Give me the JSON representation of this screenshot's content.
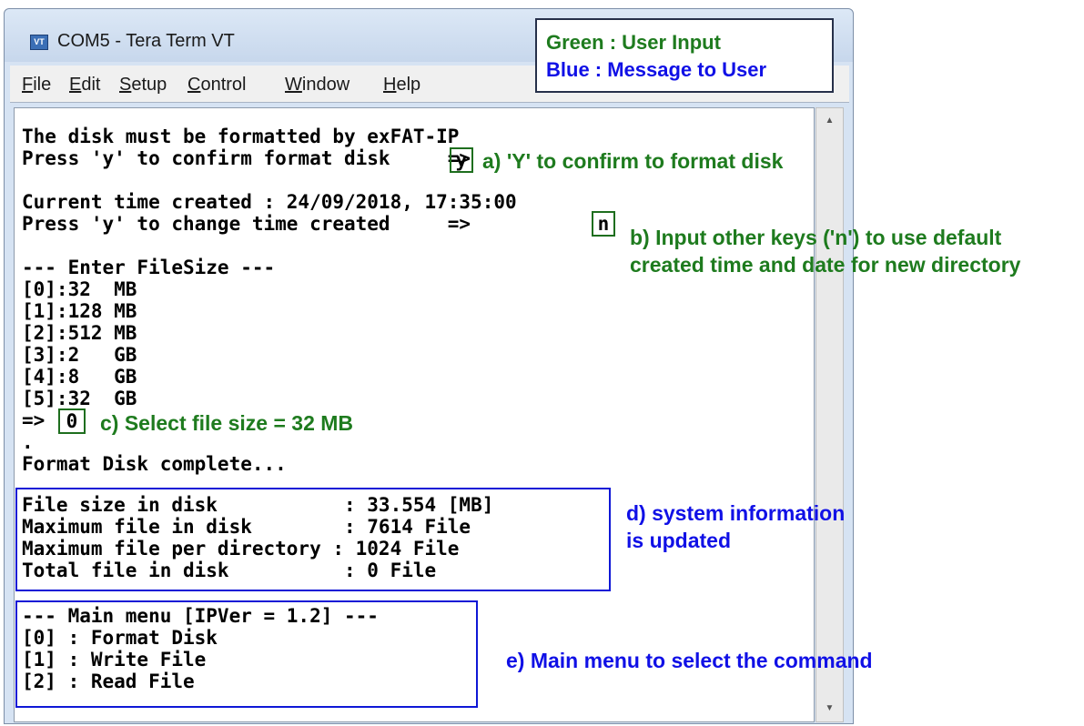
{
  "window": {
    "title": "COM5 - Tera Term VT",
    "icon_label": "VT",
    "menu": [
      "File",
      "Edit",
      "Setup",
      "Control",
      "Window",
      "Help"
    ],
    "menu_access_keys": [
      "F",
      "E",
      "S",
      "C",
      "W",
      "H"
    ]
  },
  "legend": {
    "user_input": "Green : User Input",
    "message": "Blue : Message to User",
    "colors": {
      "user_input": "#1e7b1e",
      "message": "#1010e6"
    }
  },
  "terminal": {
    "lines": [
      "The disk must be formatted by exFAT-IP",
      "Press 'y' to confirm format disk     =>",
      "Current time created : 24/09/2018, 17:35:00",
      "Press 'y' to change time created     =>",
      "--- Enter FileSize ---",
      "[0]:32  MB",
      "[1]:128 MB",
      "[2]:512 MB",
      "[3]:2   GB",
      "[4]:8   GB",
      "[5]:32  GB",
      "=>",
      ".",
      "Format Disk complete...",
      "File size in disk           : 33.554 [MB]",
      "Maximum file in disk        : 7614 File",
      "Maximum file per directory : 1024 File",
      "Total file in disk          : 0 File",
      "--- Main menu [IPVer = 1.2] ---",
      "[0] : Format Disk",
      "[1] : Write File",
      "[2] : Read File"
    ],
    "inputs": {
      "confirm_format": "y",
      "change_time": "n",
      "file_size": "0"
    }
  },
  "annotations": {
    "a": "a) 'Y' to confirm to format disk",
    "b1": "b) Input other keys ('n') to use default",
    "b2": "created time and date for new directory",
    "c": "c) Select file size = 32 MB",
    "d1": "d) system information",
    "d2": "is updated",
    "e": "e) Main menu to select the command"
  },
  "scrollbar": {
    "up_icon": "▲",
    "down_icon": "▼"
  }
}
